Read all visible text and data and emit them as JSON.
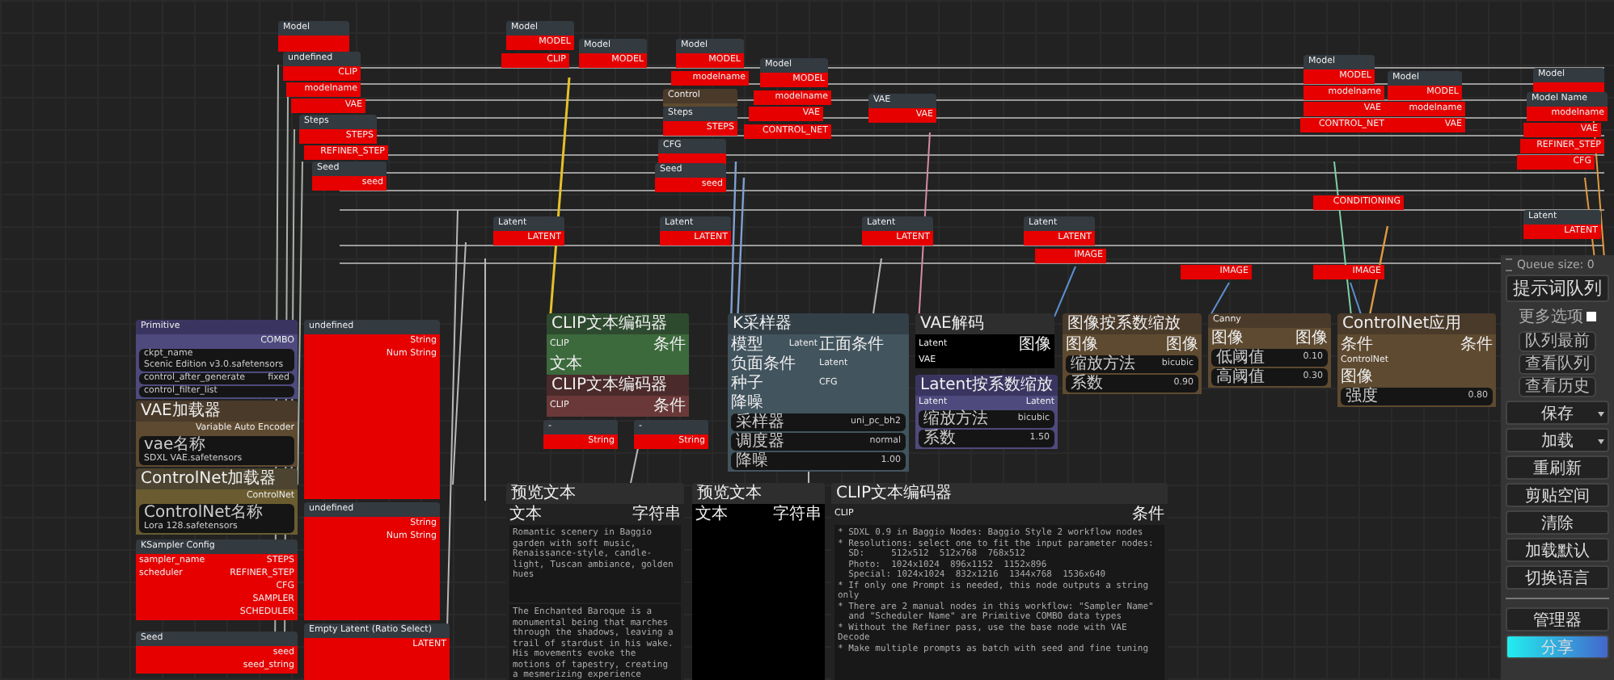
{
  "nodes": [
    {
      "title": "Model",
      "kind": "red"
    },
    {
      "title": "undefined",
      "kind": "red",
      "outputs": [
        "CLIP"
      ]
    },
    {
      "kind": "red",
      "outputs": [
        "modelname"
      ]
    },
    {
      "kind": "red",
      "outputs": [
        "VAE"
      ]
    },
    {
      "title": "Steps",
      "kind": "red",
      "outputs": [
        "STEPS"
      ]
    },
    {
      "kind": "red",
      "outputs": [
        "REFINER_STEP"
      ]
    },
    {
      "title": "Seed",
      "kind": "red",
      "outputs": [
        "seed"
      ]
    },
    {
      "title": "Model",
      "kind": "red",
      "outputs": [
        "MODEL"
      ]
    },
    {
      "kind": "red",
      "outputs": [
        "CLIP"
      ]
    },
    {
      "title": "Model",
      "kind": "red",
      "outputs": [
        "MODEL"
      ]
    },
    {
      "title": "Model",
      "kind": "red",
      "outputs": [
        "MODEL"
      ]
    },
    {
      "kind": "red",
      "outputs": [
        "modelname"
      ]
    },
    {
      "title": "Model",
      "kind": "red",
      "outputs": [
        "MODEL"
      ]
    },
    {
      "title": "Control",
      "kind": "brown"
    },
    {
      "kind": "red",
      "outputs": [
        "modelname"
      ]
    },
    {
      "title": "Steps",
      "kind": "red",
      "outputs": [
        "STEPS"
      ]
    },
    {
      "kind": "red",
      "outputs": [
        "VAE"
      ]
    },
    {
      "kind": "red",
      "outputs": [
        "CONTROL_NET"
      ]
    },
    {
      "title": "VAE",
      "kind": "red",
      "outputs": [
        "VAE"
      ]
    },
    {
      "title": "CFG",
      "kind": "red"
    },
    {
      "title": "Seed",
      "kind": "red",
      "outputs": [
        "seed"
      ]
    },
    {
      "title": "Model",
      "kind": "red",
      "outputs": [
        "MODEL"
      ]
    },
    {
      "kind": "red",
      "outputs": [
        "modelname"
      ]
    },
    {
      "kind": "red",
      "outputs": [
        "VAE"
      ]
    },
    {
      "kind": "red",
      "outputs": [
        "CONTROL_NET"
      ]
    },
    {
      "title": "Model",
      "kind": "red",
      "outputs": [
        "MODEL"
      ]
    },
    {
      "kind": "red",
      "outputs": [
        "modelname"
      ]
    },
    {
      "kind": "red",
      "outputs": [
        "VAE"
      ]
    },
    {
      "title": "Model",
      "kind": "red"
    },
    {
      "title": "Model Name",
      "kind": "red",
      "outputs": [
        "modelname"
      ]
    },
    {
      "kind": "red",
      "outputs": [
        "VAE"
      ]
    },
    {
      "kind": "red",
      "outputs": [
        "REFINER_STEP"
      ]
    },
    {
      "kind": "red",
      "outputs": [
        "CFG"
      ]
    },
    {
      "kind": "red",
      "outputs": [
        "CONDITIONING"
      ]
    },
    {
      "title": "Latent",
      "kind": "red",
      "outputs": [
        "LATENT"
      ]
    },
    {
      "title": "Latent",
      "kind": "red",
      "outputs": [
        "LATENT"
      ]
    },
    {
      "title": "Latent",
      "kind": "red",
      "outputs": [
        "LATENT"
      ]
    },
    {
      "title": "Latent",
      "kind": "red",
      "outputs": [
        "LATENT"
      ]
    },
    {
      "kind": "red",
      "outputs": [
        "IMAGE"
      ]
    },
    {
      "kind": "red",
      "outputs": [
        "IMAGE"
      ]
    },
    {
      "kind": "red",
      "outputs": [
        "IMAGE"
      ]
    },
    {
      "title": "Latent",
      "kind": "red",
      "outputs": [
        "LATENT"
      ]
    },
    {
      "title": "Primitive",
      "kind": "purple",
      "outputs": [
        "COMBO"
      ],
      "widgets": [
        {
          "label": "ckpt_name",
          "value": "Scenic Edition v3.0.safetensors"
        },
        {
          "label": "control_after_generate",
          "value": "fixed"
        },
        {
          "label": "control_filter_list"
        }
      ]
    },
    {
      "title": "VAE加载器",
      "kind": "brown",
      "outputs": [
        "Variable Auto Encoder"
      ],
      "widgets": [
        {
          "label": "vae名称",
          "value": "SDXL VAE.safetensors"
        }
      ]
    },
    {
      "title": "ControlNet加载器",
      "kind": "olive",
      "outputs": [
        "ControlNet"
      ],
      "widgets": [
        {
          "label": "ControlNet名称",
          "value": "Lora 128.safetensors"
        }
      ]
    },
    {
      "title": "KSampler Config",
      "kind": "red",
      "inputs": [
        "sampler_name",
        "scheduler"
      ],
      "outputs": [
        "STEPS",
        "REFINER_STEP",
        "CFG",
        "SAMPLER",
        "SCHEDULER"
      ]
    },
    {
      "title": "Seed",
      "kind": "red",
      "outputs": [
        "seed",
        "seed_string"
      ]
    },
    {
      "title": "undefined",
      "kind": "red",
      "outputs": [
        "String",
        "Num String"
      ]
    },
    {
      "title": "undefined",
      "kind": "red",
      "outputs": [
        "String",
        "Num String"
      ]
    },
    {
      "title": "Empty Latent (Ratio Select)",
      "kind": "red",
      "outputs": [
        "LATENT"
      ]
    },
    {
      "title": "CLIP文本编码器",
      "kind": "green",
      "inputs": [
        "CLIP",
        "文本"
      ],
      "outputs": [
        "条件"
      ]
    },
    {
      "title": "CLIP文本编码器",
      "kind": "maroon",
      "inputs": [
        "CLIP"
      ],
      "outputs": [
        "条件"
      ]
    },
    {
      "title": "-",
      "kind": "red",
      "outputs": [
        "String"
      ]
    },
    {
      "title": "-",
      "kind": "red",
      "outputs": [
        "String"
      ]
    },
    {
      "title": "K采样器",
      "kind": "slate",
      "inputs": [
        "模型",
        "正面条件",
        "负面条件",
        "Latent",
        "种子",
        "CFG",
        "降噪"
      ],
      "outputs": [
        "Latent"
      ],
      "widgets": [
        {
          "label": "采样器",
          "value": "uni_pc_bh2"
        },
        {
          "label": "调度器",
          "value": "normal"
        },
        {
          "label": "降噪",
          "value": "1.00"
        }
      ]
    },
    {
      "title": "VAE解码",
      "kind": "black",
      "inputs": [
        "Latent",
        "VAE"
      ],
      "outputs": [
        "图像"
      ]
    },
    {
      "title": "Latent按系数缩放",
      "kind": "purple",
      "inputs": [
        "Latent"
      ],
      "outputs": [
        "Latent"
      ],
      "widgets": [
        {
          "label": "缩放方法",
          "value": "bicubic"
        },
        {
          "label": "系数",
          "value": "1.50"
        }
      ]
    },
    {
      "title": "图像按系数缩放",
      "kind": "brown",
      "inputs": [
        "图像"
      ],
      "outputs": [
        "图像"
      ],
      "widgets": [
        {
          "label": "缩放方法",
          "value": "bicubic"
        },
        {
          "label": "系数",
          "value": "0.90"
        }
      ]
    },
    {
      "title": "Canny",
      "kind": "brown",
      "inputs": [
        "图像"
      ],
      "outputs": [
        "图像"
      ],
      "widgets": [
        {
          "label": "低阈值",
          "value": "0.10"
        },
        {
          "label": "高阈值",
          "value": "0.30"
        }
      ]
    },
    {
      "title": "ControlNet应用",
      "kind": "brown",
      "inputs": [
        "条件",
        "ControlNet",
        "图像"
      ],
      "outputs": [
        "条件"
      ],
      "widgets": [
        {
          "label": "强度",
          "value": "0.80"
        }
      ]
    },
    {
      "title": "预览文本",
      "kind": "text",
      "inputs": [
        "文本"
      ],
      "outputs": [
        "字符串"
      ],
      "texts": [
        "Romantic scenery in Baggio garden with soft music, Renaissance-style, candle-light, Tuscan ambiance, golden hues",
        "The Enchanted Baroque is a monumental being that marches through the shadows, leaving a trail of stardust in his wake. His movements evoke the motions of tapestry, creating a mesmerizing experience"
      ]
    },
    {
      "title": "预览文本",
      "kind": "black",
      "inputs": [
        "文本"
      ],
      "outputs": [
        "字符串"
      ]
    },
    {
      "title": "CLIP文本编码器",
      "kind": "text",
      "inputs": [
        "CLIP"
      ],
      "outputs": [
        "条件"
      ],
      "texts": [
        "* SDXL 0.9 in Baggio Nodes: Baggio Style 2 workflow nodes\n* Resolutions: select one to fit the input parameter nodes:\n  SD:     512x512  512x768  768x512\n  Photo:  1024x1024  896x1152  1152x896\n  Special: 1024x1024  832x1216  1344x768  1536x640\n* If only one Prompt is needed, this node outputs a string only\n* There are 2 manual nodes in this workflow: \"Sampler Name\"\n  and \"Scheduler Name\" are Primitive COMBO data types\n* Without the Refiner pass, use the base node with VAE Decode\n* Make multiple prompts as batch with seed and fine tuning"
      ]
    }
  ],
  "menu": {
    "queue_label": "Queue size: 0",
    "queue_button": "提示词队列",
    "extra_options": {
      "label": "更多选项",
      "checked": false
    },
    "small_buttons": [
      "队列最前",
      "查看队列",
      "查看历史"
    ],
    "buttons": [
      {
        "label": "保存",
        "dropdown": true
      },
      {
        "label": "加载",
        "dropdown": true
      },
      {
        "label": "重刷新",
        "dropdown": false
      },
      {
        "label": "剪贴空间",
        "dropdown": false
      },
      {
        "label": "清除",
        "dropdown": false
      },
      {
        "label": "加载默认",
        "dropdown": false
      },
      {
        "label": "切换语言",
        "dropdown": false
      }
    ],
    "footer_buttons": [
      {
        "label": "管理器",
        "kind": "plain"
      },
      {
        "label": "分享",
        "kind": "share"
      }
    ]
  }
}
